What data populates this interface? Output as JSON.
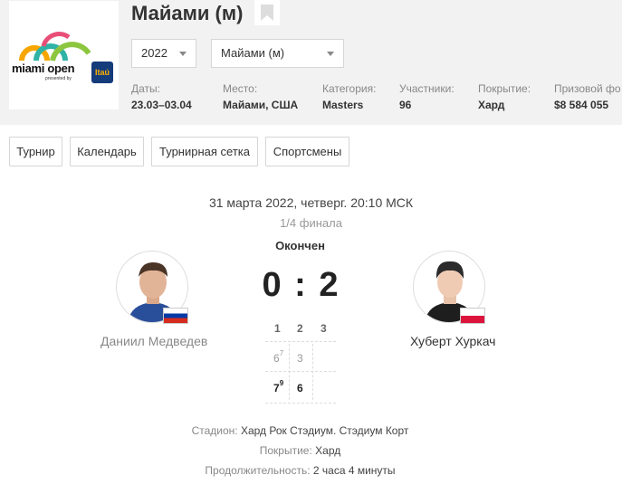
{
  "tournament": {
    "title": "Майами (м)",
    "logo": {
      "line1": "miami open",
      "line2": "presented by",
      "sponsor": "Itaú"
    },
    "year_select": "2022",
    "tour_select": "Майами (м)",
    "info": [
      {
        "label": "Даты:",
        "value": "23.03–03.04"
      },
      {
        "label": "Место:",
        "value": "Майами, США"
      },
      {
        "label": "Категория:",
        "value": "Masters"
      },
      {
        "label": "Участники:",
        "value": "96"
      },
      {
        "label": "Покрытие:",
        "value": "Хард"
      },
      {
        "label": "Призовой фо",
        "value": "$8 584 055"
      }
    ]
  },
  "nav": [
    "Турнир",
    "Календарь",
    "Турнирная сетка",
    "Спортсмены"
  ],
  "match": {
    "datetime": "31 марта 2022, четверг. 20:10 МСК",
    "round": "1/4 финала",
    "status": "Окончен",
    "score": "0 : 2",
    "player1": {
      "name": "Даниил Медведев",
      "country": "RU"
    },
    "player2": {
      "name": "Хуберт Хуркач",
      "country": "PL"
    },
    "set_headers": [
      "1",
      "2",
      "3"
    ],
    "p1_sets": [
      {
        "games": "6",
        "tb": "7"
      },
      {
        "games": "3",
        "tb": ""
      },
      {
        "games": "",
        "tb": ""
      }
    ],
    "p2_sets": [
      {
        "games": "7",
        "tb": "9"
      },
      {
        "games": "6",
        "tb": ""
      },
      {
        "games": "",
        "tb": ""
      }
    ]
  },
  "details": [
    {
      "label": "Стадион:",
      "value": "Хард Рок Стэдиум. Стэдиум Корт"
    },
    {
      "label": "Покрытие:",
      "value": "Хард"
    },
    {
      "label": "Продолжительность:",
      "value": "2 часа 4 минуты"
    }
  ],
  "colors": {
    "header_bg": "#f2f2f2",
    "ru_blue": "#0039a6",
    "ru_red": "#d52b1e",
    "pl_red": "#dc143c"
  }
}
